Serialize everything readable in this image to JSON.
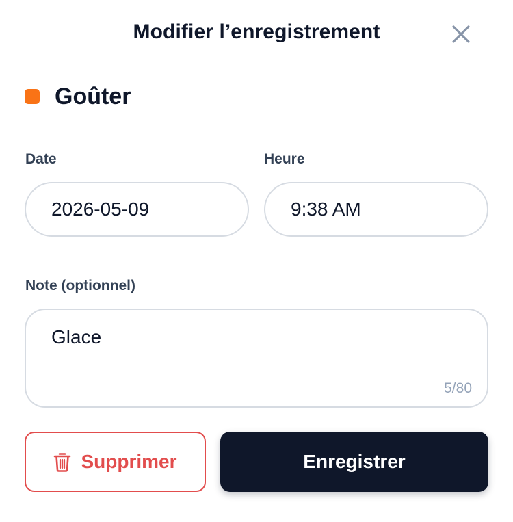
{
  "dialog": {
    "title": "Modifier l’enregistrement",
    "close_icon": "close-icon"
  },
  "category": {
    "label": "Goûter",
    "color": "#f97316"
  },
  "date": {
    "label": "Date",
    "value": "2026-05-09"
  },
  "time": {
    "label": "Heure",
    "value": "9:38 AM"
  },
  "note": {
    "label": "Note (optionnel)",
    "value": "Glace",
    "char_count": "5/80"
  },
  "actions": {
    "delete_label": "Supprimer",
    "delete_icon": "trash-icon",
    "delete_color": "#e24d4d",
    "save_label": "Enregistrer",
    "save_bg": "#0f172a"
  }
}
